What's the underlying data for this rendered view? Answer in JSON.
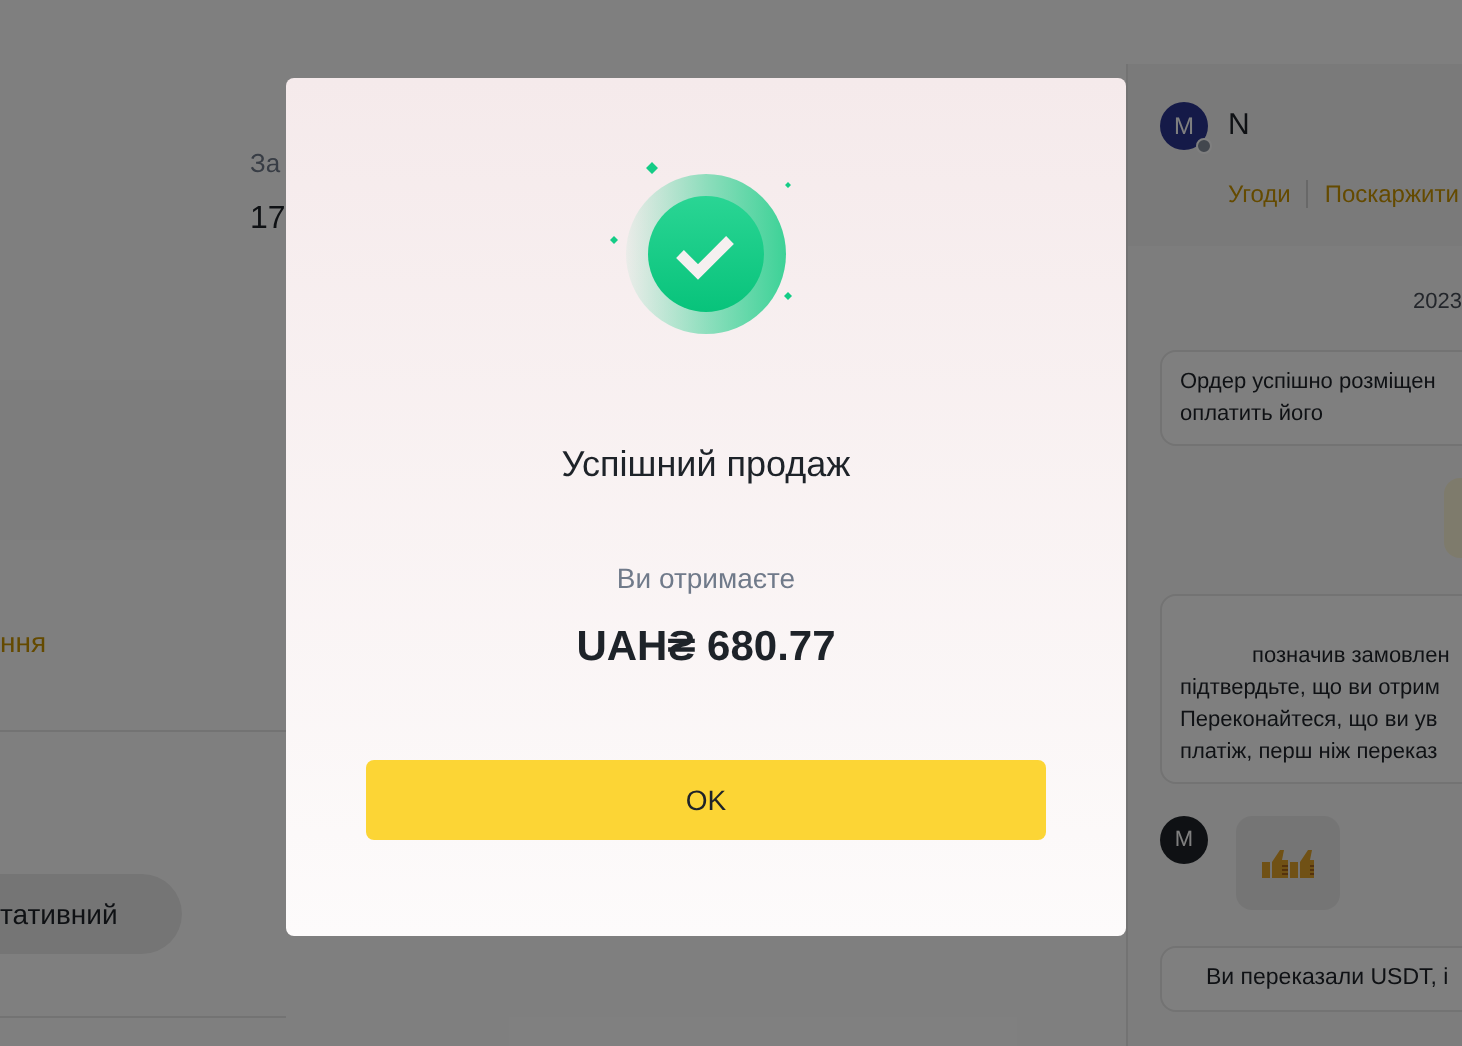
{
  "background": {
    "left_panel": {
      "label": "За",
      "value": "17",
      "link": "ння",
      "pill": "тативний"
    },
    "chat": {
      "user": {
        "avatar": "M",
        "name": "N"
      },
      "tabs": [
        {
          "label": "Угоди"
        },
        {
          "label": "Поскаржити"
        }
      ],
      "date": "2023",
      "messages": [
        {
          "kind": "system",
          "lines": [
            "Ордер успішно розміщен",
            "оплатить його"
          ]
        },
        {
          "kind": "outgoing"
        },
        {
          "kind": "system",
          "lines": [
            "позначив замовлен",
            "підтвердьте, що ви отрим",
            "Переконайтеся, що ви ув",
            "платіж, перш ніж переказ"
          ]
        },
        {
          "kind": "sticker",
          "avatar": "M"
        },
        {
          "kind": "notice",
          "lines": [
            "Ви переказали USDT, і"
          ]
        }
      ]
    }
  },
  "dialog": {
    "title": "Успішний продаж",
    "subtitle": "Ви отримаєте",
    "amount": "UAH₴ 680.77",
    "button": "OK"
  }
}
